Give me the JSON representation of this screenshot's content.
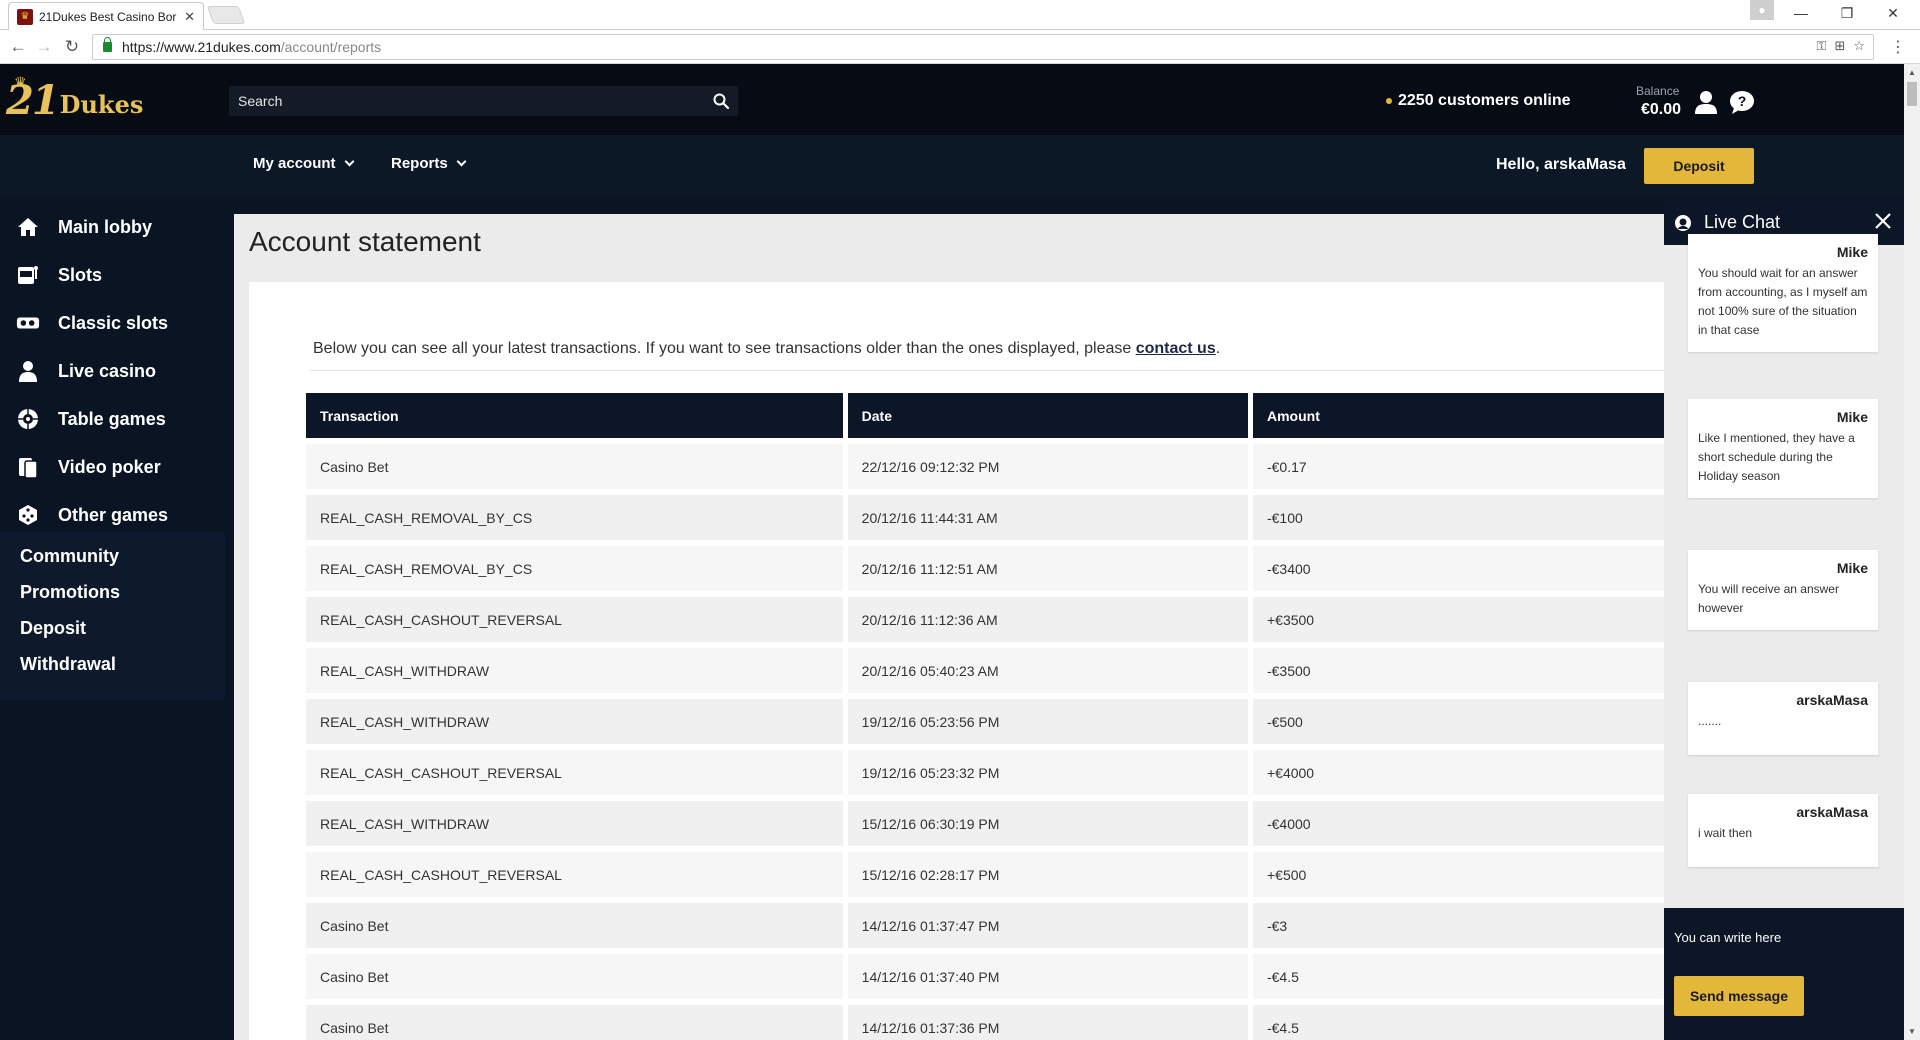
{
  "browser": {
    "tab_title": "21Dukes Best Casino Bor",
    "url_host": "https://www.21dukes.com",
    "url_path": "/account/reports"
  },
  "header": {
    "logo_num": "21",
    "logo_text": "Dukes",
    "search_placeholder": "Search",
    "customers_online": "2250 customers online",
    "balance_label": "Balance",
    "balance_value": "€0.00"
  },
  "nav": {
    "my_account": "My account",
    "reports": "Reports",
    "hello": "Hello, arskaMasa",
    "deposit": "Deposit"
  },
  "sidebar": {
    "items": [
      {
        "label": "Main lobby",
        "icon": "home-icon"
      },
      {
        "label": "Slots",
        "icon": "slot-machine-icon"
      },
      {
        "label": "Classic slots",
        "icon": "cherries-icon"
      },
      {
        "label": "Live casino",
        "icon": "dealer-icon"
      },
      {
        "label": "Table games",
        "icon": "roulette-icon"
      },
      {
        "label": "Video poker",
        "icon": "cards-icon"
      },
      {
        "label": "Other games",
        "icon": "dice-icon"
      }
    ],
    "links": [
      "Community",
      "Promotions",
      "Deposit",
      "Withdrawal"
    ]
  },
  "main": {
    "title": "Account statement",
    "intro_before": "Below you can see all your latest transactions. If you want to see transactions older than the ones displayed, please ",
    "intro_link": "contact us",
    "intro_after": ".",
    "columns": [
      "Transaction",
      "Date",
      "Amount"
    ],
    "rows": [
      [
        "Casino Bet",
        "22/12/16 09:12:32 PM",
        "-€0.17"
      ],
      [
        "REAL_CASH_REMOVAL_BY_CS",
        "20/12/16 11:44:31 AM",
        "-€100"
      ],
      [
        "REAL_CASH_REMOVAL_BY_CS",
        "20/12/16 11:12:51 AM",
        "-€3400"
      ],
      [
        "REAL_CASH_CASHOUT_REVERSAL",
        "20/12/16 11:12:36 AM",
        "+€3500"
      ],
      [
        "REAL_CASH_WITHDRAW",
        "20/12/16 05:40:23 AM",
        "-€3500"
      ],
      [
        "REAL_CASH_WITHDRAW",
        "19/12/16 05:23:56 PM",
        "-€500"
      ],
      [
        "REAL_CASH_CASHOUT_REVERSAL",
        "19/12/16 05:23:32 PM",
        "+€4000"
      ],
      [
        "REAL_CASH_WITHDRAW",
        "15/12/16 06:30:19 PM",
        "-€4000"
      ],
      [
        "REAL_CASH_CASHOUT_REVERSAL",
        "15/12/16 02:28:17 PM",
        "+€500"
      ],
      [
        "Casino Bet",
        "14/12/16 01:37:47 PM",
        "-€3"
      ],
      [
        "Casino Bet",
        "14/12/16 01:37:40 PM",
        "-€4.5"
      ],
      [
        "Casino Bet",
        "14/12/16 01:37:36 PM",
        "-€4.5"
      ]
    ]
  },
  "chat": {
    "title": "Live Chat",
    "messages": [
      {
        "author": "Mike",
        "text": "You should wait for an answer from accounting, as I myself am not 100% sure of the situation in that case"
      },
      {
        "author": "Mike",
        "text": "Like I mentioned, they have a short schedule during the Holiday season"
      },
      {
        "author": "Mike",
        "text": "You will receive an answer however"
      },
      {
        "author": "arskaMasa",
        "text": "......."
      },
      {
        "author": "arskaMasa",
        "text": "i wait then"
      }
    ],
    "input_placeholder": "You can write here",
    "send_label": "Send message"
  },
  "colors": {
    "accent": "#e3b83a",
    "header_bg": "#060b14",
    "nav_bg": "#0d1827",
    "table_header_bg": "#0c1626"
  }
}
